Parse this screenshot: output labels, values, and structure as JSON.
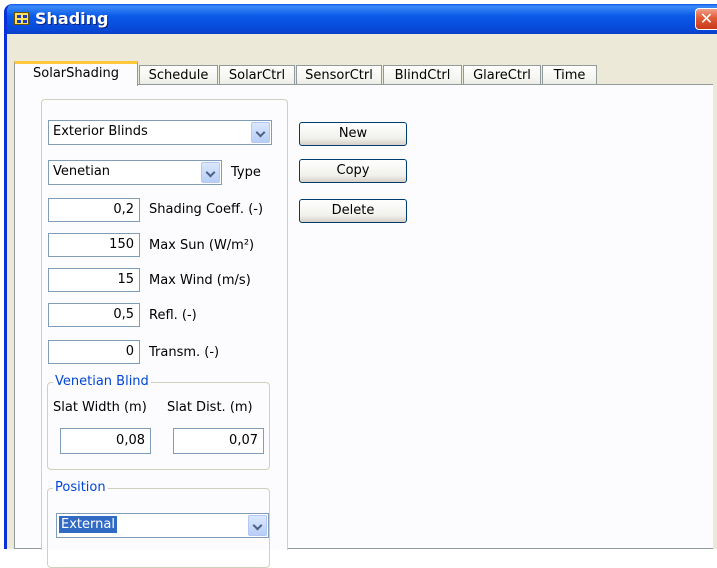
{
  "window": {
    "title": "Shading",
    "close_glyph": "✕"
  },
  "tabs": [
    {
      "label": "SolarShading",
      "active": true
    },
    {
      "label": "Schedule"
    },
    {
      "label": "SolarCtrl"
    },
    {
      "label": "SensorCtrl"
    },
    {
      "label": "BlindCtrl"
    },
    {
      "label": "GlareCtrl"
    },
    {
      "label": "Time"
    }
  ],
  "shading_device": {
    "selected": "Exterior Blinds"
  },
  "type": {
    "selected": "Venetian",
    "label": "Type"
  },
  "fields": [
    {
      "value": "0,2",
      "label": "Shading Coeff. (-)"
    },
    {
      "value": "150",
      "label": "Max Sun (W/m²)"
    },
    {
      "value": "15",
      "label": "Max Wind (m/s)"
    },
    {
      "value": "0,5",
      "label": "Refl. (-)"
    },
    {
      "value": "0",
      "label": "Transm. (-)"
    }
  ],
  "buttons": {
    "new": "New",
    "copy": "Copy",
    "delete": "Delete"
  },
  "venetian_blind": {
    "title": "Venetian Blind",
    "slat_width_label": "Slat Width (m)",
    "slat_dist_label": "Slat Dist. (m)",
    "slat_width": "0,08",
    "slat_dist": "0,07"
  },
  "position": {
    "title": "Position",
    "selected": "External"
  },
  "colors": {
    "title_bar": "#0a5ae8",
    "group_title": "#0046d5",
    "selection": "#316ac5",
    "tab_highlight": "#ffc83c"
  }
}
